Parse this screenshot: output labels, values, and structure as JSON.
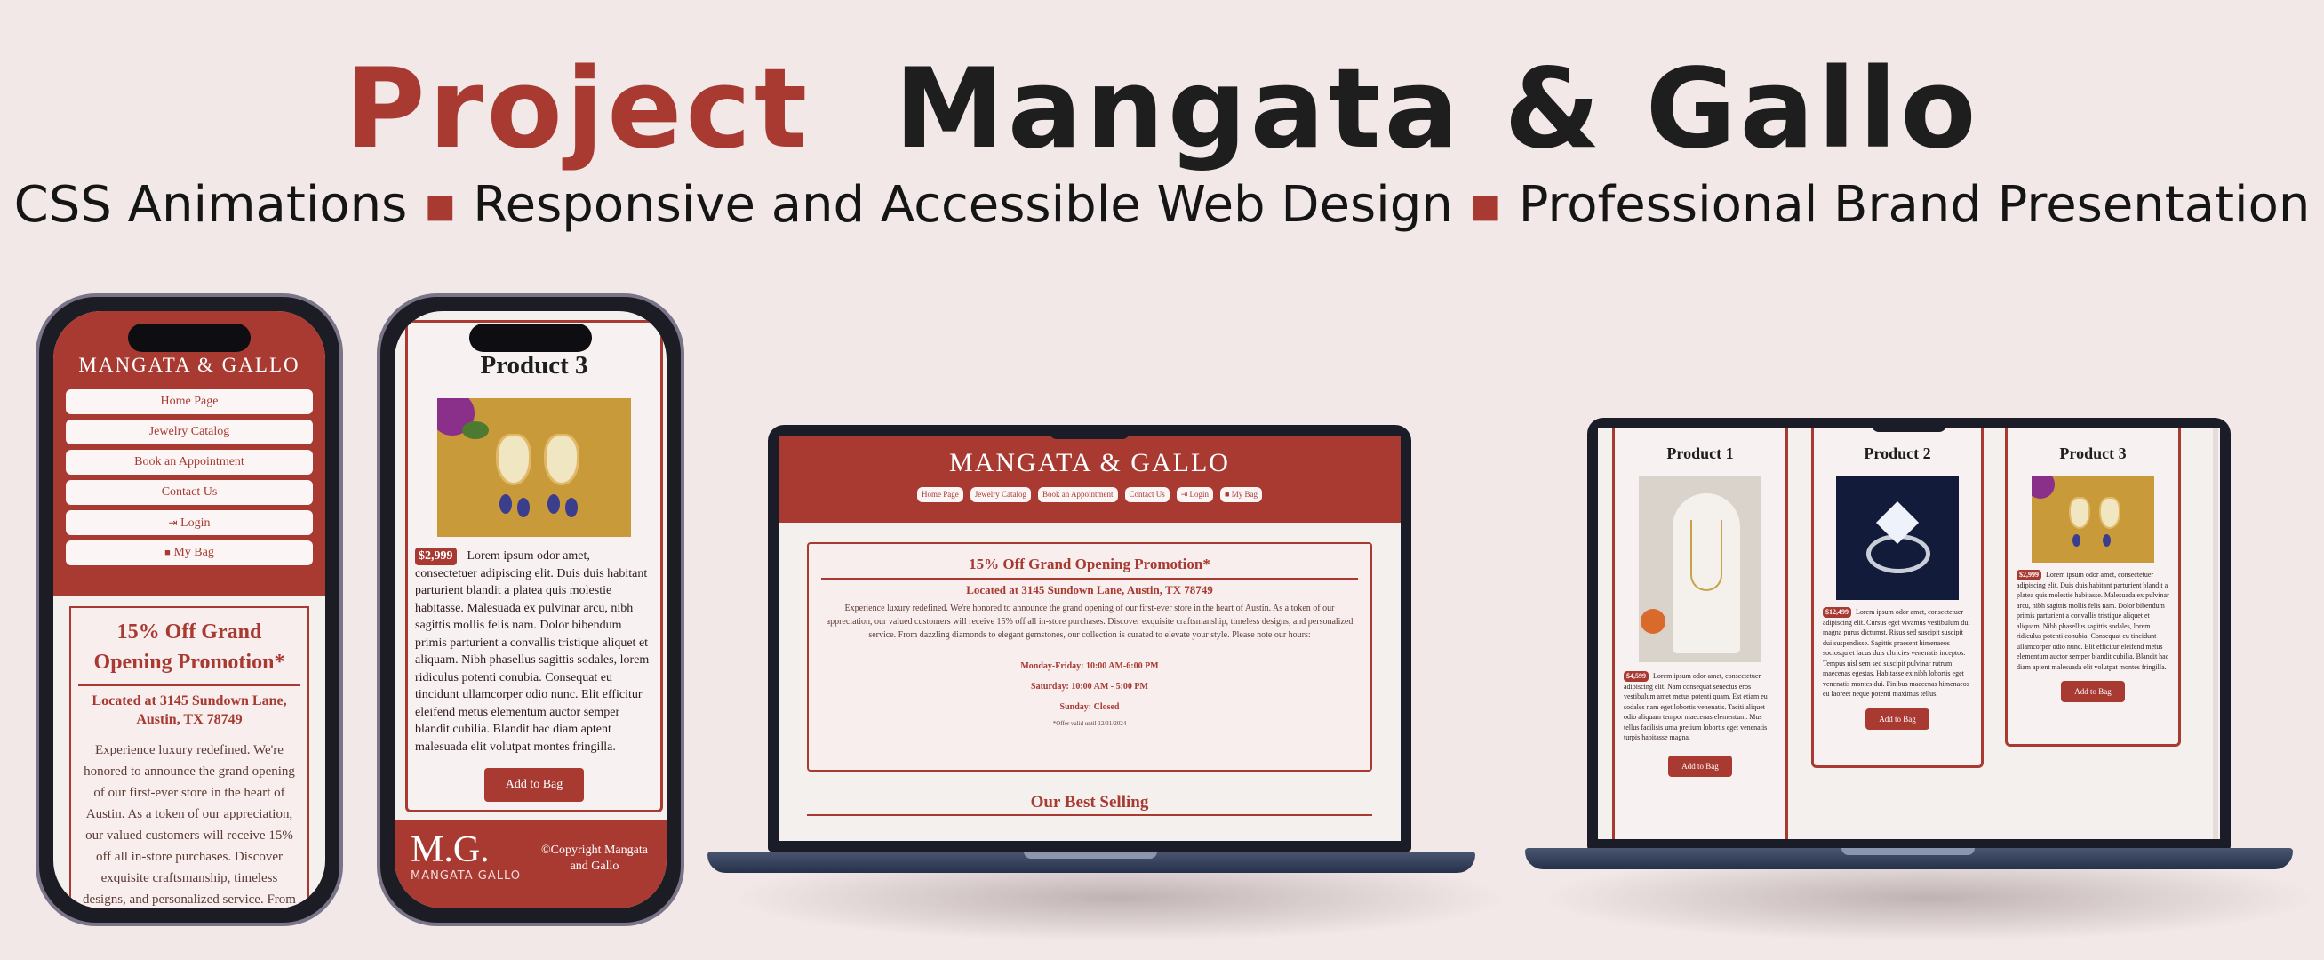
{
  "headline": {
    "word_project": "Project",
    "word_brand": "Mangata & Gallo"
  },
  "subline": {
    "item1": "CSS Animations",
    "item2": "Responsive and Accessible Web Design",
    "item3": "Professional Brand Presentation",
    "separator": "▪"
  },
  "colors": {
    "accent": "#a83a32",
    "background": "#f2e8e8",
    "device": "#1c1c24"
  },
  "brand": {
    "logo": "MANGATA & GALLO",
    "logo_mark": "M.G.",
    "logo_sub": "MANGATA GALLO",
    "copyright": "©Copyright Mangata and Gallo"
  },
  "nav": {
    "home": "Home Page",
    "catalog": "Jewelry Catalog",
    "appointment": "Book an Appointment",
    "contact": "Contact Us",
    "login": "Login",
    "bag": "My Bag"
  },
  "icons": {
    "login": "login-icon",
    "bag": "bag-icon"
  },
  "promo": {
    "title": "15% Off Grand Opening Promotion*",
    "address": "Located at 3145 Sundown Lane, Austin, TX 78749",
    "body": "Experience luxury redefined. We're honored to announce the grand opening of our first-ever store in the heart of Austin. As a token of our appreciation, our valued customers will receive 15% off all in-store purchases. Discover exquisite craftsmanship, timeless designs, and personalized service. From dazzling diamonds to elegant gemstones, our collection is curated to elevate your style. Please note our hours:",
    "phone_body": "Experience luxury redefined. We're honored to announce the grand opening of our first-ever store in the heart of Austin. As a token of our appreciation, our valued customers will receive 15% off all in-store purchases. Discover exquisite craftsmanship, timeless designs, and personalized service. From dazzling diamonds to elegant gemstones, our",
    "hours_weekday": "Monday-Friday: 10:00 AM-6:00 PM",
    "hours_saturday": "Saturday: 10:00 AM - 5:00 PM",
    "hours_sunday": "Sunday: Closed",
    "footnote": "*Offer valid until 12/31/2024"
  },
  "best_selling": "Our Best Selling",
  "add_to_bag": "Add to Bag",
  "products": [
    {
      "title": "Product 1",
      "price": "$4,599",
      "text": "Lorem ipsum odor amet, consectetuer adipiscing elit. Nam consequat senectus eros vestibulum amet metus potenti quam. Est etiam eu sodales nam eget lobortis venenatis. Taciti aliquet odio aliquam tempor maecenas elementum. Mus tellus facilisis urna pretium lobortis eget venenatis turpis habitasse magna."
    },
    {
      "title": "Product 2",
      "price": "$12,499",
      "text": "Lorem ipsum odor amet, consectetuer adipiscing elit. Cursus eget vivamus vestibulum dui magna purus dictumst. Risus sed suscipit suscipit dui suspendisse. Sagittis praesent himenaeos sociosqu et lacus duis ultricies venenatis inceptos. Tempus nisl sem sed suscipit pulvinar rutrum maecenas egestas. Habitasse ex nibh lobortis eget venenatis montes dui. Finibus maecenas himenaeos eu laoreet neque potenti maximus tellus."
    },
    {
      "title": "Product 3",
      "price": "$2,999",
      "text": "Lorem ipsum odor amet, consectetuer adipiscing elit. Duis duis habitant parturient blandit a platea quis molestie habitasse. Malesuada ex pulvinar arcu, nibh sagittis mollis felis nam. Dolor bibendum primis parturient a convallis tristique aliquet et aliquam. Nibh phasellus sagittis sodales, lorem ridiculus potenti conubia. Consequat eu tincidunt ullamcorper odio nunc. Elit efficitur eleifend metus elementum auctor semper blandit cubilia. Blandit hac diam aptent malesuada elit volutpat montes fringilla."
    }
  ]
}
